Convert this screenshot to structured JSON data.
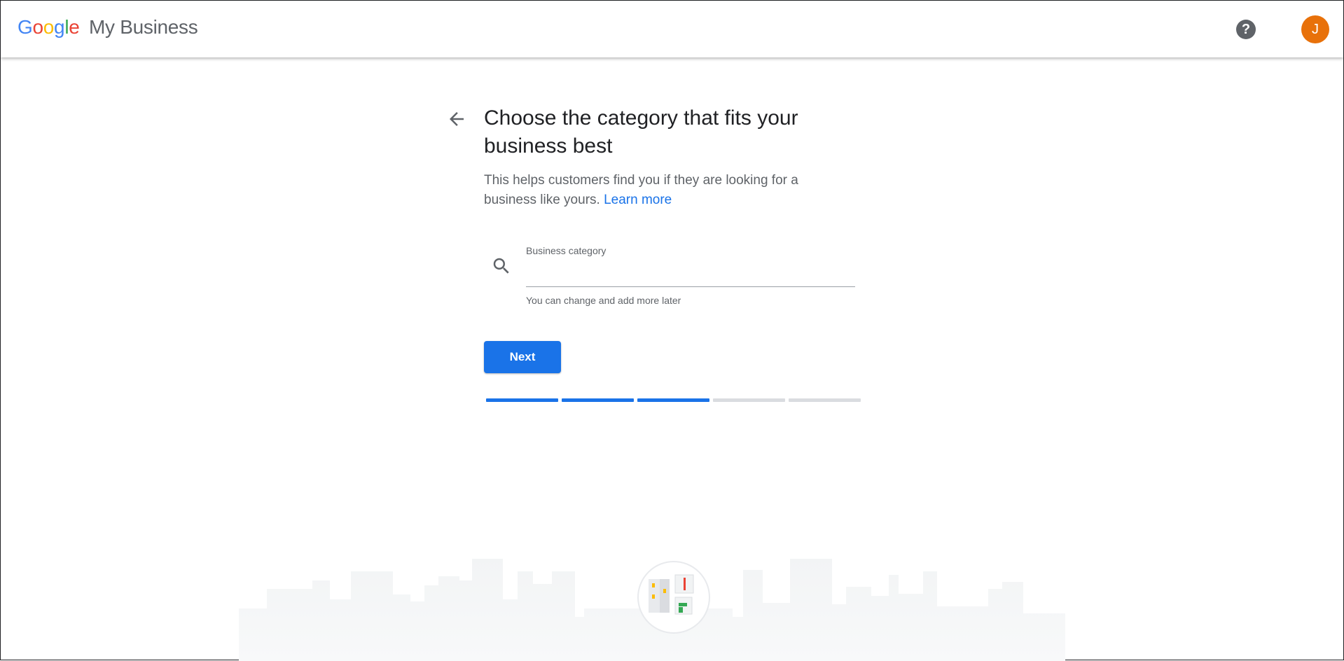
{
  "header": {
    "logo_letters": [
      {
        "char": "G",
        "color": "#4285F4"
      },
      {
        "char": "o",
        "color": "#EA4335"
      },
      {
        "char": "o",
        "color": "#FBBC05"
      },
      {
        "char": "g",
        "color": "#4285F4"
      },
      {
        "char": "l",
        "color": "#34A853"
      },
      {
        "char": "e",
        "color": "#EA4335"
      }
    ],
    "product_name": "My Business",
    "help_icon": "?",
    "avatar_initial": "J"
  },
  "main": {
    "title": "Choose the category that fits your business best",
    "subtitle": "This helps customers find you if they are looking for a business like yours.",
    "learn_more": "Learn more",
    "field": {
      "label": "Business category",
      "value": "",
      "helper": "You can change and add more later"
    },
    "next_label": "Next"
  },
  "progress": {
    "total_steps": 5,
    "completed_steps": 3,
    "active_color": "#1a73e8",
    "inactive_color": "#dadce0"
  },
  "colors": {
    "accent": "#1a73e8",
    "avatar": "#e8710a"
  }
}
